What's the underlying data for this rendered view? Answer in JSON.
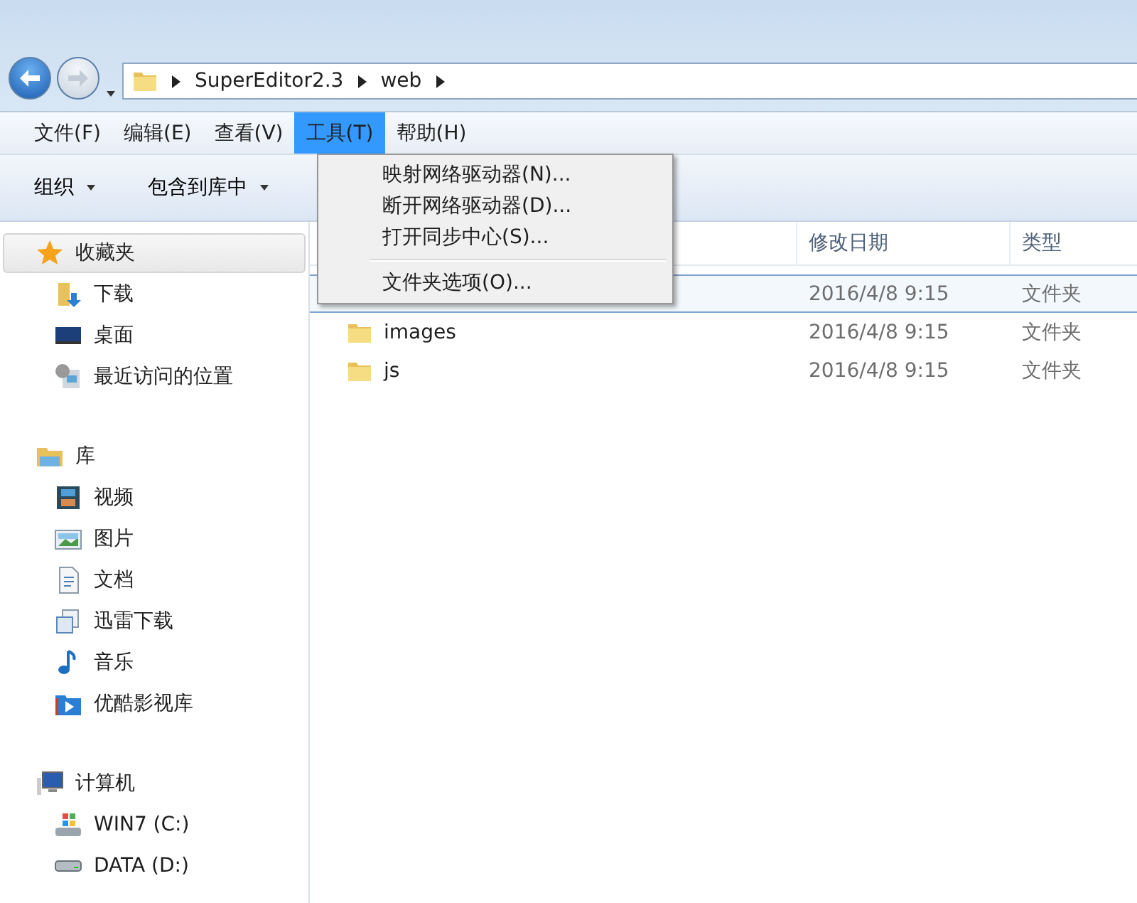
{
  "address": {
    "crumbs": [
      "SuperEditor2.3",
      "web"
    ]
  },
  "menubar": [
    {
      "label": "文件(F)",
      "selected": false
    },
    {
      "label": "编辑(E)",
      "selected": false
    },
    {
      "label": "查看(V)",
      "selected": false
    },
    {
      "label": "工具(T)",
      "selected": true
    },
    {
      "label": "帮助(H)",
      "selected": false
    }
  ],
  "toolbar": [
    "组织",
    "包含到库中"
  ],
  "menu": {
    "items": [
      {
        "label": "映射网络驱动器(N)...",
        "separator_after": false
      },
      {
        "label": "断开网络驱动器(D)...",
        "separator_after": false
      },
      {
        "label": "打开同步中心(S)...",
        "separator_after": true
      },
      {
        "label": "文件夹选项(O)...",
        "separator_after": false
      }
    ]
  },
  "sidebar": {
    "groups": [
      {
        "label": "收藏夹",
        "kind": "star",
        "selected": true,
        "items": [
          {
            "label": "下载",
            "kind": "download"
          },
          {
            "label": "桌面",
            "kind": "desktop"
          },
          {
            "label": "最近访问的位置",
            "kind": "recent"
          }
        ]
      },
      {
        "label": "库",
        "kind": "library",
        "selected": false,
        "items": [
          {
            "label": "视频",
            "kind": "video"
          },
          {
            "label": "图片",
            "kind": "image"
          },
          {
            "label": "文档",
            "kind": "document"
          },
          {
            "label": "迅雷下载",
            "kind": "librarydoc"
          },
          {
            "label": "音乐",
            "kind": "music"
          },
          {
            "label": "优酷影视库",
            "kind": "play"
          }
        ]
      },
      {
        "label": "计算机",
        "kind": "computer",
        "selected": false,
        "items": [
          {
            "label": "WIN7 (C:)",
            "kind": "systemdrive"
          },
          {
            "label": "DATA (D:)",
            "kind": "drive"
          }
        ]
      }
    ]
  },
  "table": {
    "columns": [
      "修改日期",
      "类型"
    ],
    "rows": [
      {
        "date": "2016/4/8 9:15",
        "type": "文件夹",
        "selected": true
      },
      {
        "name": "images",
        "date": "2016/4/8 9:15",
        "type": "文件夹",
        "selected": false
      },
      {
        "name": "js",
        "date": "2016/4/8 9:15",
        "type": "文件夹",
        "selected": false
      }
    ]
  }
}
